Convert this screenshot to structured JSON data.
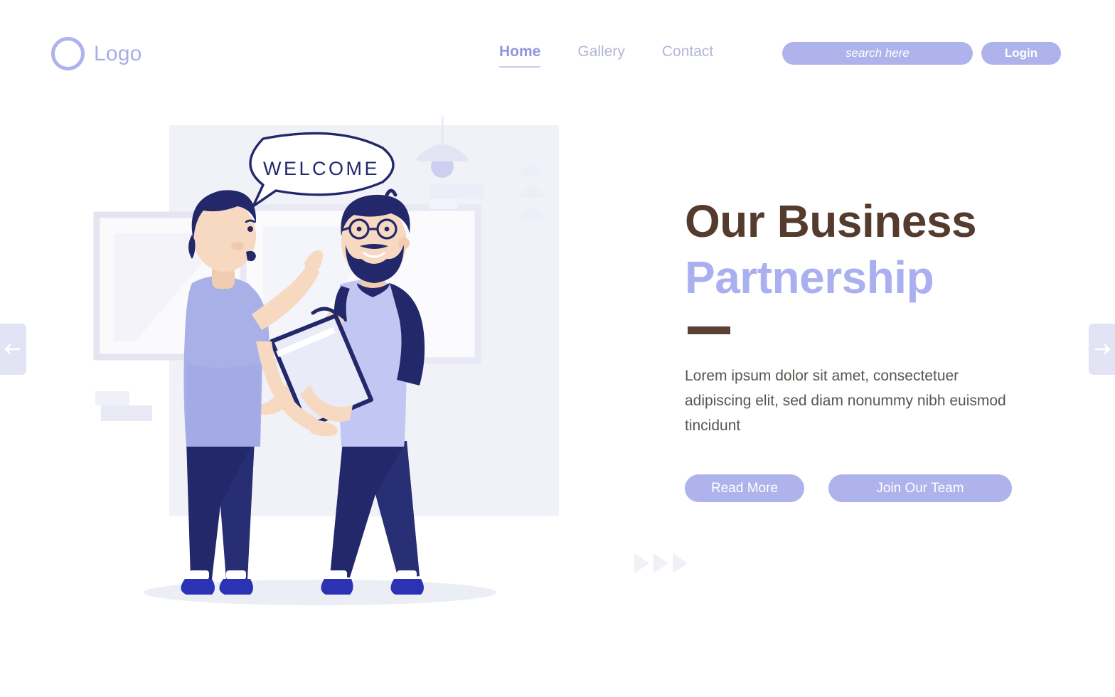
{
  "brand": {
    "logo_text": "Logo",
    "logo_icon": "circle-ring-icon"
  },
  "nav": {
    "items": [
      {
        "label": "Home",
        "active": true
      },
      {
        "label": "Gallery",
        "active": false
      },
      {
        "label": "Contact",
        "active": false
      }
    ]
  },
  "search": {
    "value": "",
    "placeholder": "search here",
    "icon": "search-icon"
  },
  "auth": {
    "login_label": "Login"
  },
  "carousel": {
    "prev_icon": "arrow-left-icon",
    "prev_label": "Previous slide",
    "next_icon": "arrow-right-icon",
    "next_label": "Next slide"
  },
  "hero": {
    "title_line1": "Our Business",
    "title_line2": "Partnership",
    "body": "Lorem ipsum dolor sit amet, consectetuer adipiscing elit, sed diam nonummy nibh euismod tincidunt",
    "cta_primary": "Read More",
    "cta_secondary": "Join Our Team"
  },
  "illustration": {
    "name": "two-businessmen-handshake-illustration",
    "speech_bubble_text": "WELCOME",
    "elements": [
      "pendant-lamp-icon",
      "stacked-triangles-icon",
      "window-panel",
      "briefcase-icon",
      "ground-shadow"
    ]
  },
  "decor": {
    "chevron_count": 3,
    "chevron_icon": "triangle-right-icon"
  },
  "colors": {
    "accent_lavender": "#aeb3ec",
    "lavender_light": "#c5c9f2",
    "title_brown": "#553b2e",
    "rule_brown": "#5b4033",
    "body_text": "#5b5550",
    "navy": "#23286b",
    "navy_deep": "#1d2260",
    "shirt_lavender": "#a9b0e8",
    "shirt_light": "#c1c7f2",
    "skin": "#f6d9c0",
    "panel_grey": "#f1f2f7",
    "arrow_box": "#e2e3f4",
    "chevron_grey": "#f0f0f7",
    "shoe_blue": "#2b33b4",
    "background": "#ffffff"
  }
}
